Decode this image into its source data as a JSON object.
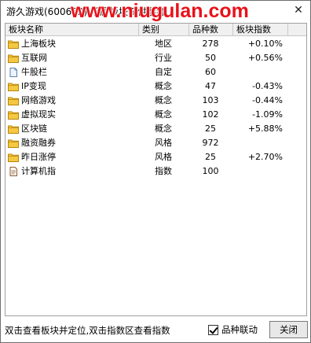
{
  "window": {
    "title": "游久游戏(600652) 所属板块仅供参考",
    "watermark": "www.niugulan.com",
    "close_glyph": "✕"
  },
  "table": {
    "columns": [
      "板块名称",
      "类别",
      "品种数",
      "板块指数"
    ],
    "rows": [
      {
        "name": "上海板块",
        "type": "地区",
        "count": "278",
        "index": "+0.10%",
        "icon": "folder-icon"
      },
      {
        "name": "互联网",
        "type": "行业",
        "count": "50",
        "index": "+0.56%",
        "icon": "folder-icon"
      },
      {
        "name": "牛股栏",
        "type": "自定",
        "count": "60",
        "index": "",
        "icon": "document-icon"
      },
      {
        "name": "IP变现",
        "type": "概念",
        "count": "47",
        "index": "-0.43%",
        "icon": "folder-icon"
      },
      {
        "name": "网络游戏",
        "type": "概念",
        "count": "103",
        "index": "-0.44%",
        "icon": "folder-icon"
      },
      {
        "name": "虚拟现实",
        "type": "概念",
        "count": "102",
        "index": "-1.09%",
        "icon": "folder-icon"
      },
      {
        "name": "区块链",
        "type": "概念",
        "count": "25",
        "index": "+5.88%",
        "icon": "folder-icon"
      },
      {
        "name": "融资融券",
        "type": "风格",
        "count": "972",
        "index": "",
        "icon": "folder-icon"
      },
      {
        "name": "昨日涨停",
        "type": "风格",
        "count": "25",
        "index": "+2.70%",
        "icon": "folder-icon"
      },
      {
        "name": "计算机指",
        "type": "指数",
        "count": "100",
        "index": "",
        "icon": "index-doc-icon"
      }
    ]
  },
  "footer": {
    "hint": "双击查看板块并定位,双击指数区查看指数",
    "checkbox_label": "品种联动",
    "checkbox_checked": true,
    "close_label": "关闭"
  },
  "colors": {
    "watermark": "#e8121a",
    "folder_fill": "#f5c842",
    "folder_edge": "#b8860b"
  }
}
